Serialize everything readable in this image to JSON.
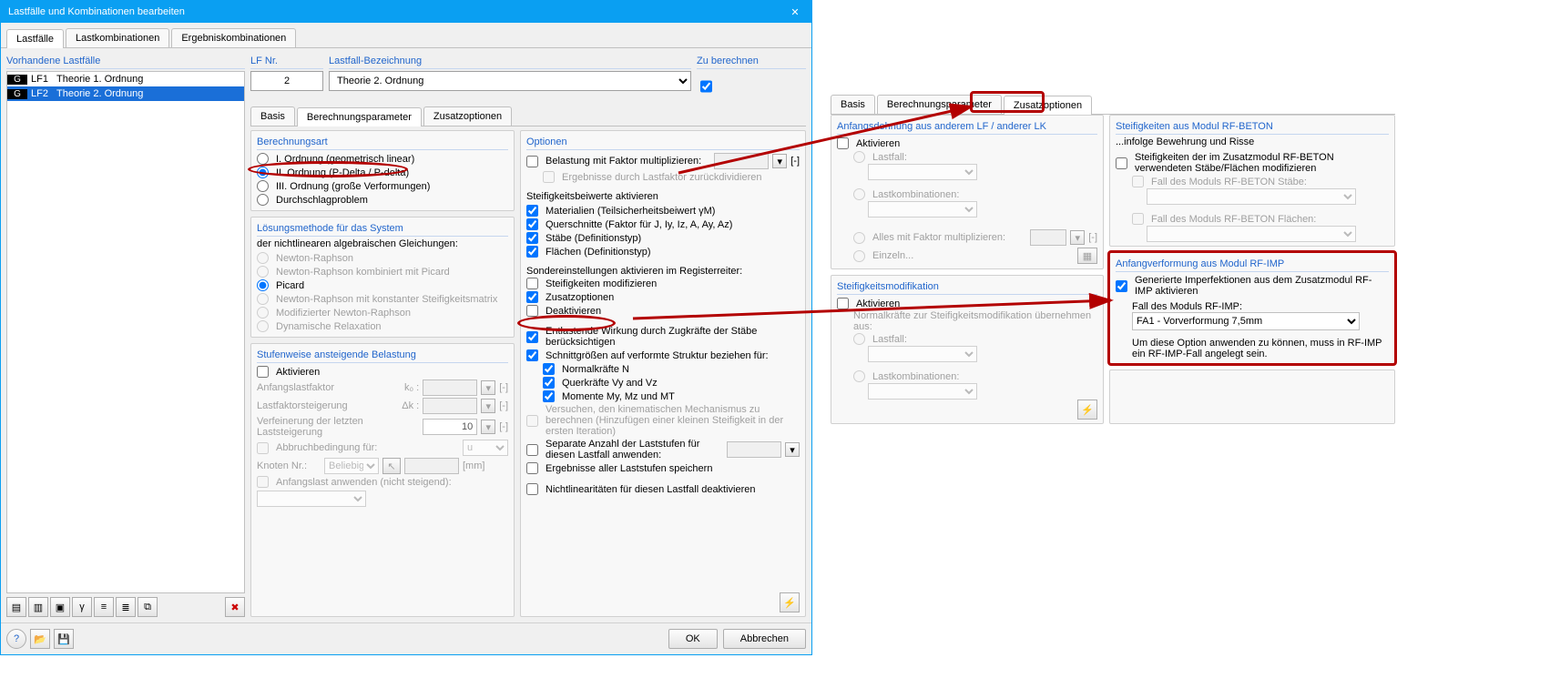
{
  "title": "Lastfälle und Kombinationen bearbeiten",
  "mainTabs": {
    "t0": "Lastfälle",
    "t1": "Lastkombinationen",
    "t2": "Ergebniskombinationen"
  },
  "left": {
    "header": "Vorhandene Lastfälle",
    "tag1": "G",
    "num1": "LF1",
    "name1": "Theorie 1. Ordnung",
    "tag2": "G",
    "num2": "LF2",
    "name2": "Theorie 2. Ordnung"
  },
  "top": {
    "lfnr_label": "LF Nr.",
    "lfnr_val": "2",
    "bez_label": "Lastfall-Bezeichnung",
    "bez_val": "Theorie 2. Ordnung",
    "calc_label": "Zu berechnen"
  },
  "subTabs": {
    "s0": "Basis",
    "s1": "Berechnungsparameter",
    "s2": "Zusatzoptionen"
  },
  "calcart": {
    "header": "Berechnungsart",
    "o1": "I. Ordnung (geometrisch linear)",
    "o2": "II. Ordnung (P-Delta / P-delta)",
    "o3": "III. Ordnung (große Verformungen)",
    "o4": "Durchschlagproblem"
  },
  "solve": {
    "header": "Lösungsmethode für das System",
    "sub": "der nichtlinearen algebraischen Gleichungen:",
    "m1": "Newton-Raphson",
    "m2": "Newton-Raphson kombiniert mit Picard",
    "m3": "Picard",
    "m4": "Newton-Raphson mit konstanter Steifigkeitsmatrix",
    "m5": "Modifizierter Newton-Raphson",
    "m6": "Dynamische Relaxation"
  },
  "step": {
    "header": "Stufenweise ansteigende Belastung",
    "act": "Aktivieren",
    "f1": "Anfangslastfaktor",
    "f1s": "k₀ :",
    "u1": "[-]",
    "f2": "Lastfaktorsteigerung",
    "f2s": "Δk :",
    "u2": "[-]",
    "f3": "Verfeinerung der letzten Laststeigerung",
    "f3v": "10",
    "u3": "[-]",
    "f4": "Abbruchbedingung für:",
    "f4v": "u",
    "f5": "Knoten Nr.:",
    "f5v": "Beliebig",
    "u5": "[mm]",
    "f6": "Anfangslast anwenden (nicht steigend):"
  },
  "opts": {
    "header": "Optionen",
    "o1": "Belastung mit Faktor multiplizieren:",
    "u1": "[-]",
    "o1b": "Ergebnisse durch Lastfaktor zurückdividieren",
    "stiff_header": "Steifigkeitsbeiwerte aktivieren",
    "s1": "Materialien (Teilsicherheitsbeiwert γM)",
    "s2": "Querschnitte (Faktor für J, Iy, Iz, A, Ay, Az)",
    "s3": "Stäbe (Definitionstyp)",
    "s4": "Flächen (Definitionstyp)",
    "special_header": "Sondereinstellungen aktivieren im Registerreiter:",
    "sp1": "Steifigkeiten modifizieren",
    "sp2": "Zusatzoptionen",
    "sp3": "Deaktivieren",
    "e1": "Entlastende Wirkung durch Zugkräfte der Stäbe berücksichtigen",
    "e2": "Schnittgrößen auf verformte Struktur beziehen für:",
    "e2a": "Normalkräfte N",
    "e2b": "Querkräfte Vy and Vz",
    "e2c": "Momente My, Mz und MT",
    "e3": "Versuchen, den kinematischen Mechanismus zu berechnen (Hinzufügen einer kleinen Steifigkeit in der ersten Iteration)",
    "e4": "Separate Anzahl der Laststufen für diesen Lastfall anwenden:",
    "e5": "Ergebnisse aller Laststufen speichern",
    "e6": "Nichtlinearitäten für diesen Lastfall deaktivieren"
  },
  "footer": {
    "ok": "OK",
    "cancel": "Abbrechen"
  },
  "zp": {
    "anf": {
      "header": "Anfangsdehnung aus anderem LF / anderer LK",
      "act": "Aktivieren",
      "lf": "Lastfall:",
      "lk": "Lastkombinationen:",
      "all": "Alles mit Faktor multiplizieren:",
      "allu": "[-]",
      "single": "Einzeln..."
    },
    "sm": {
      "header": "Steifigkeitsmodifikation",
      "act": "Aktivieren",
      "note": "Normalkräfte zur Steifigkeitsmodifikation übernehmen aus:",
      "lf": "Lastfall:",
      "lk": "Lastkombinationen:"
    },
    "beton": {
      "header": "Steifigkeiten aus Modul RF-BETON",
      "sub": "...infolge Bewehrung und Risse",
      "c1": "Steifigkeiten der im Zusatzmodul RF-BETON verwendeten Stäbe/Flächen modifizieren",
      "c2": "Fall des Moduls RF-BETON Stäbe:",
      "c3": "Fall des Moduls RF-BETON Flächen:"
    },
    "imp": {
      "header": "Anfangverformung aus Modul RF-IMP",
      "c1": "Generierte Imperfektionen aus dem Zusatzmodul RF-IMP aktivieren",
      "lbl": "Fall des Moduls RF-IMP:",
      "val": "FA1 - Vorverformung 7,5mm",
      "note": "Um diese Option anwenden zu können, muss in RF-IMP ein RF-IMP-Fall angelegt sein."
    }
  }
}
